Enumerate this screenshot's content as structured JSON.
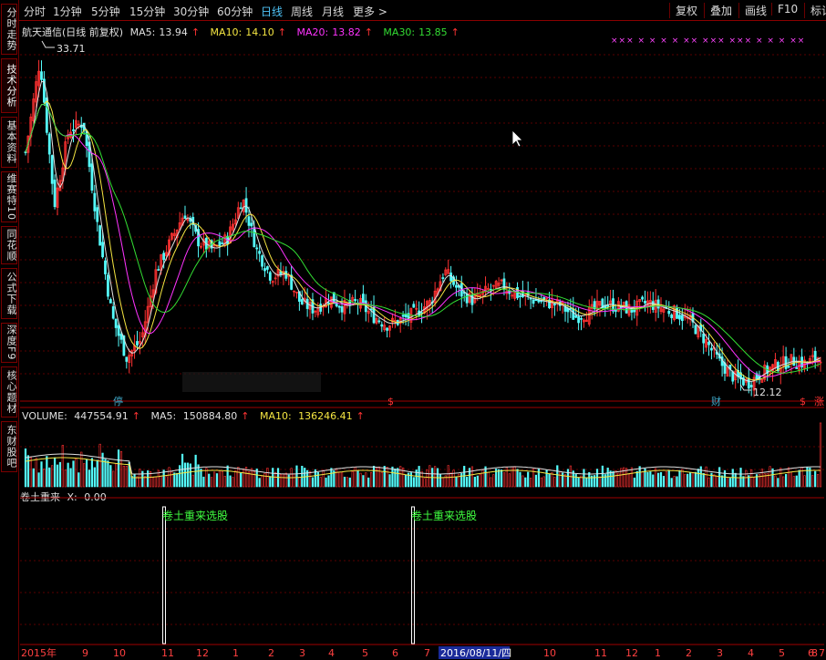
{
  "sidebar": {
    "tabs": [
      "分时走势",
      "技术分析",
      "基本资料",
      "维赛特10",
      "同花顺",
      "公式下载",
      "深度F9",
      "核心题材",
      "东财股吧"
    ],
    "active_index": 1
  },
  "toolbar": {
    "periods": [
      "分时",
      "1分钟",
      "5分钟",
      "15分钟",
      "30分钟",
      "60分钟",
      "日线",
      "周线",
      "月线",
      "更多 >"
    ],
    "active_period": "日线",
    "right_buttons": [
      "复权",
      "叠加",
      "画线",
      "F10",
      "标记"
    ]
  },
  "main_panel": {
    "stock_title": "航天通信(日线 前复权)",
    "ma5": {
      "label": "MA5:",
      "value": "13.94",
      "arrow": "↑",
      "color": "#e0e0e0"
    },
    "ma10": {
      "label": "MA10:",
      "value": "14.10",
      "arrow": "↑",
      "color": "#f5e642"
    },
    "ma20": {
      "label": "MA20:",
      "value": "13.82",
      "arrow": "↑",
      "color": "#ff33ff"
    },
    "ma30": {
      "label": "MA30:",
      "value": "13.85",
      "arrow": "↑",
      "color": "#33dd33"
    },
    "high_label": "33.71",
    "low_label": "12.12",
    "markers": [
      {
        "text": "停",
        "color": "#3fa9c9"
      },
      {
        "text": "$",
        "color": "#ff3333"
      },
      {
        "text": "财",
        "color": "#3fa9c9"
      },
      {
        "text": "$",
        "color": "#ff3333"
      },
      {
        "text": "涨",
        "color": "#ff3333"
      }
    ],
    "info_markers": "××× × × × × ×× ××× ××× × × × ××"
  },
  "volume_panel": {
    "volume": {
      "label": "VOLUME:",
      "value": "447554.91",
      "arrow": "↑",
      "color": "#e0e0e0"
    },
    "ma5": {
      "label": "MA5:",
      "value": "150884.80",
      "arrow": "↑",
      "color": "#e0e0e0"
    },
    "ma10": {
      "label": "MA10:",
      "value": "136246.41",
      "arrow": "↑",
      "color": "#f5e642"
    }
  },
  "signal_panel": {
    "name": "卷土重来",
    "x_label": "X:",
    "x_value": "0.00",
    "signal_label": "卷土重来选股"
  },
  "x_axis": {
    "labels": [
      "2015年",
      "9",
      "10",
      "11",
      "12",
      "1",
      "2",
      "3",
      "4",
      "5",
      "6",
      "7",
      "8",
      "2016/08/11/四",
      "10",
      "11",
      "12",
      "1",
      "2",
      "3",
      "4",
      "5",
      "6",
      "7",
      "8"
    ],
    "cursor_date": "2016/08/11/四"
  },
  "chart_data": {
    "type": "candlestick",
    "title": "航天通信(日线 前复权)",
    "y_range": [
      11.5,
      35.0
    ],
    "extremes": {
      "high": 33.71,
      "low": 12.12
    },
    "close_path": [
      {
        "x": "2015-07",
        "y": 27.5
      },
      {
        "x": "2015-07",
        "y": 33.71
      },
      {
        "x": "2015-07",
        "y": 24.0
      },
      {
        "x": "2015-08",
        "y": 29.0
      },
      {
        "x": "2015-08",
        "y": 29.5
      },
      {
        "x": "2015-08",
        "y": 22.5
      },
      {
        "x": "2015-09",
        "y": 16.5
      },
      {
        "x": "2015-09",
        "y": 13.8
      },
      {
        "x": "2015-09",
        "y": 15.0
      },
      {
        "x": "2015-10",
        "y": 19.5
      },
      {
        "x": "2015-10",
        "y": 21.5
      },
      {
        "x": "2015-11",
        "y": 23.5
      },
      {
        "x": "2015-11",
        "y": 21.5
      },
      {
        "x": "2015-11",
        "y": 21.0
      },
      {
        "x": "2015-12",
        "y": 21.8
      },
      {
        "x": "2015-12",
        "y": 24.5
      },
      {
        "x": "2015-12",
        "y": 21.0
      },
      {
        "x": "2016-01",
        "y": 19.2
      },
      {
        "x": "2016-01",
        "y": 19.5
      },
      {
        "x": "2016-02",
        "y": 17.5
      },
      {
        "x": "2016-02",
        "y": 17.0
      },
      {
        "x": "2016-03",
        "y": 17.8
      },
      {
        "x": "2016-03",
        "y": 17.2
      },
      {
        "x": "2016-04",
        "y": 17.5
      },
      {
        "x": "2016-04",
        "y": 16.6
      },
      {
        "x": "2016-05",
        "y": 16.0
      },
      {
        "x": "2016-05",
        "y": 16.3
      },
      {
        "x": "2016-06",
        "y": 16.8
      },
      {
        "x": "2016-06",
        "y": 17.5
      },
      {
        "x": "2016-07",
        "y": 19.6
      },
      {
        "x": "2016-07",
        "y": 18.2
      },
      {
        "x": "2016-08",
        "y": 17.6
      },
      {
        "x": "2016-08",
        "y": 18.3
      },
      {
        "x": "2016-09",
        "y": 18.6
      },
      {
        "x": "2016-09",
        "y": 18.0
      },
      {
        "x": "2016-10",
        "y": 17.7
      },
      {
        "x": "2016-10",
        "y": 17.5
      },
      {
        "x": "2016-11",
        "y": 17.3
      },
      {
        "x": "2016-12",
        "y": 16.5
      },
      {
        "x": "2016-12",
        "y": 16.8
      },
      {
        "x": "2017-01",
        "y": 17.4
      },
      {
        "x": "2017-02",
        "y": 17.2
      },
      {
        "x": "2017-02",
        "y": 17.0
      },
      {
        "x": "2017-03",
        "y": 17.5
      },
      {
        "x": "2017-03",
        "y": 17.1
      },
      {
        "x": "2017-04",
        "y": 16.8
      },
      {
        "x": "2017-04",
        "y": 16.2
      },
      {
        "x": "2017-05",
        "y": 15.0
      },
      {
        "x": "2017-05",
        "y": 13.5
      },
      {
        "x": "2017-06",
        "y": 12.5
      },
      {
        "x": "2017-06",
        "y": 12.12
      },
      {
        "x": "2017-06",
        "y": 12.8
      },
      {
        "x": "2017-07",
        "y": 13.3
      },
      {
        "x": "2017-07",
        "y": 13.6
      },
      {
        "x": "2017-08",
        "y": 13.4
      },
      {
        "x": "2017-08",
        "y": 13.94
      }
    ],
    "volume_range": [
      0,
      460000
    ],
    "volume_latest": 447554.91,
    "signal_dates": [
      "2015-11",
      "2016-08"
    ]
  }
}
